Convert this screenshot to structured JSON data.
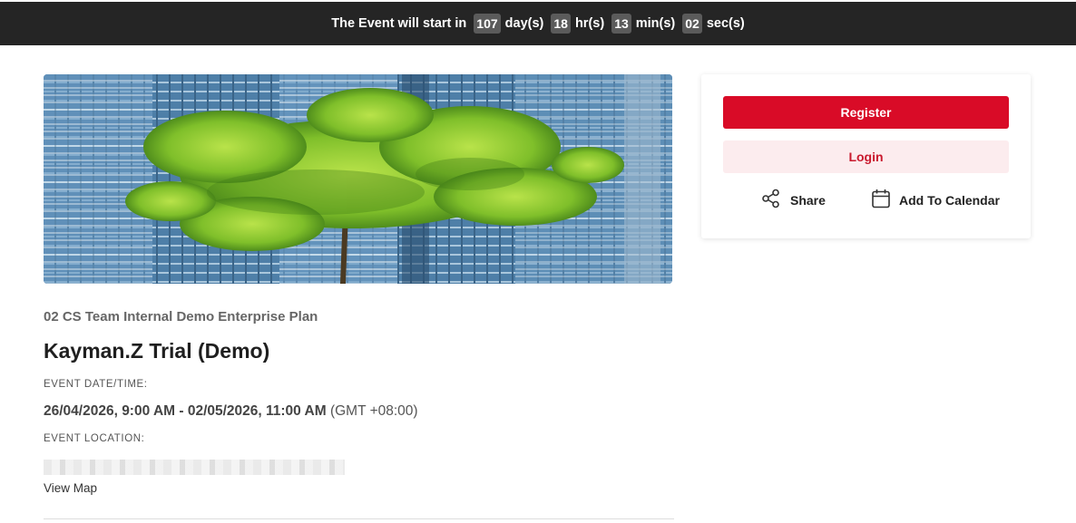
{
  "countdown": {
    "lead": "The Event will start in",
    "days": "107",
    "days_unit": "day(s)",
    "hours": "18",
    "hours_unit": "hr(s)",
    "minutes": "13",
    "minutes_unit": "min(s)",
    "seconds": "02",
    "seconds_unit": "sec(s)"
  },
  "event": {
    "organizer": "02 CS Team Internal Demo Enterprise Plan",
    "title": "Kayman.Z Trial (Demo)",
    "datetime_label": "EVENT DATE/TIME:",
    "datetime_range": "26/04/2026, 9:00 AM - 02/05/2026, 11:00 AM",
    "timezone": "(GMT +08:00)",
    "location_label": "EVENT LOCATION:",
    "view_map": "View Map"
  },
  "sidebar": {
    "register_label": "Register",
    "login_label": "Login",
    "share_label": "Share",
    "calendar_label": "Add To Calendar"
  },
  "colors": {
    "topbar_bg": "#252525",
    "register_bg": "#d90b27",
    "login_bg": "#fcecee",
    "login_text": "#c91a2e"
  },
  "icons": [
    "share-icon",
    "calendar-icon"
  ]
}
